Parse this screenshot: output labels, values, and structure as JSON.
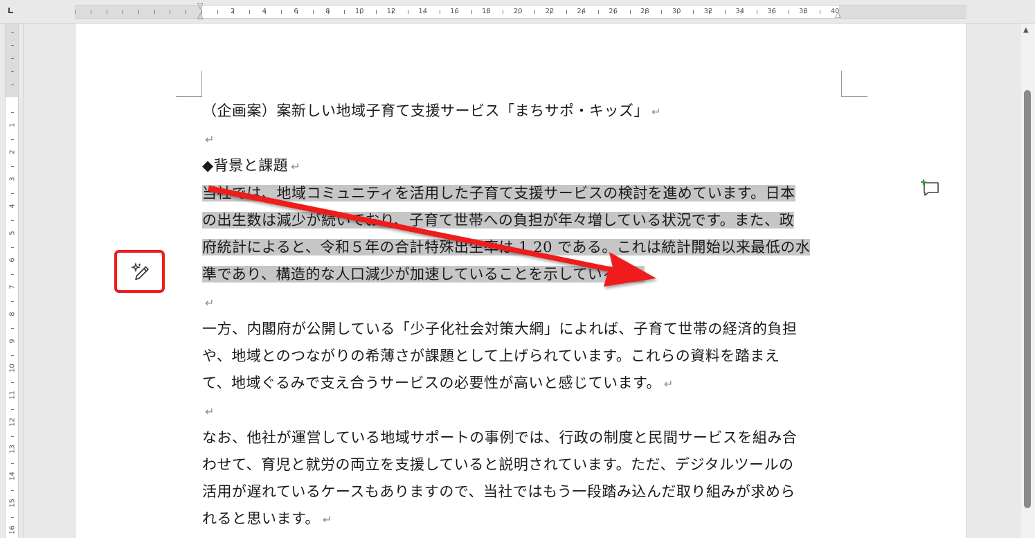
{
  "ruler": {
    "top_numbers": [
      "2",
      "4",
      "6",
      "8",
      "10",
      "12",
      "14",
      "16",
      "18",
      "20",
      "22",
      "24",
      "26",
      "28",
      "30",
      "32",
      "34",
      "36",
      "38",
      "40"
    ],
    "left_numbers": [
      "1",
      "2",
      "3",
      "4",
      "5",
      "6",
      "7",
      "8",
      "9",
      "10",
      "11",
      "12",
      "13",
      "14",
      "15",
      "16"
    ]
  },
  "document": {
    "title": "（企画案）案新しい地域子育て支援サービス「まちサポ・キッズ」",
    "heading": "◆背景と課題",
    "para1_lines": [
      "当社では、地域コミュニティを活用した子育て支援サービスの検討を進めています。日本",
      "の出生数は減少が続いており、子育て世帯への負担が年々増している状況です。また、政",
      "府統計によると、令和５年の合計特殊出生率は 1.20 である。これは統計開始以来最低の水",
      "準であり、構造的な人口減少が加速していることを示している。"
    ],
    "para2_lines": [
      "一方、内閣府が公開している「少子化社会対策大綱」によれば、子育て世帯の経済的負担",
      "や、地域とのつながりの希薄さが課題として上げられています。これらの資料を踏まえ",
      "て、地域ぐるみで支え合うサービスの必要性が高いと感じています。"
    ],
    "para3_lines": [
      "なお、他社が運営している地域サポートの事例では、行政の制度と民間サービスを組み合",
      "わせて、育児と就労の両立を支援していると説明されています。ただ、デジタルツールの",
      "活用が遅れているケースもありますので、当社ではもう一段踏み込んだ取り組みが求めら",
      "れると思います。"
    ],
    "paragraph_mark": "↵"
  },
  "icons": {
    "ai_rewrite": "sparkle-pen-icon",
    "new_comment": "comment-add-icon",
    "scroll_up": "triangle-up-icon"
  },
  "colors": {
    "highlight_box": "#ee1c1c",
    "arrow": "#ee1c1c",
    "selection": "#c6c6c6",
    "comment_plus": "#2e9e3e"
  }
}
